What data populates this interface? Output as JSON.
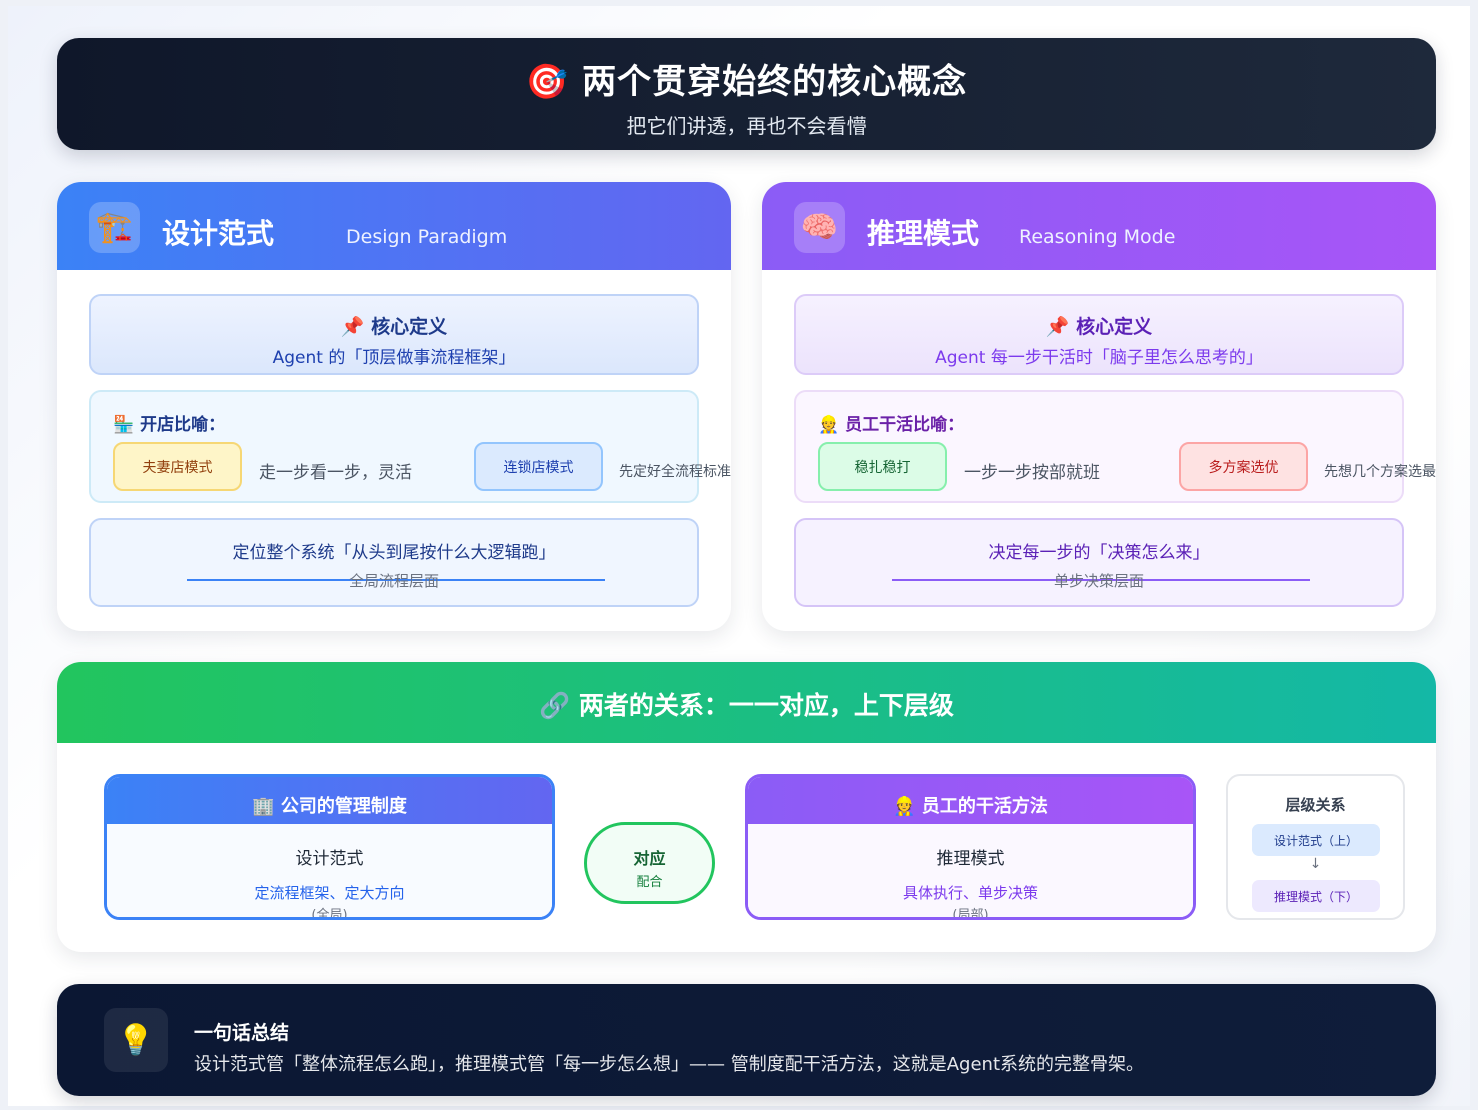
{
  "header": {
    "icon": "target-icon",
    "title": "🎯 两个贯穿始终的核心概念",
    "subtitle": "把它们讲透，再也不会看懵"
  },
  "design": {
    "icon_name": "crane-icon",
    "icon": "🏗️",
    "title": "设计范式",
    "subtitle": "Design Paradigm",
    "def_label": "📌 核心定义",
    "def_text": "Agent 的「顶层做事流程框架」",
    "metaphor_label": "🏪 开店比喻：",
    "chip1": "夫妻店模式",
    "chip1_text": "走一步看一步，灵活",
    "chip2": "连锁店模式",
    "chip2_text": "先定好全流程标准",
    "position_text": "定位整个系统「从头到尾按什么大逻辑跑」",
    "position_tag": "全局流程层面",
    "color": "#3b82f6"
  },
  "reasoning": {
    "icon_name": "brain-icon",
    "icon": "🧠",
    "title": "推理模式",
    "subtitle": "Reasoning Mode",
    "def_label": "📌 核心定义",
    "def_text": "Agent 每一步干活时「脑子里怎么思考的」",
    "metaphor_label": "👷 员工干活比喻：",
    "chip1": "稳扎稳打",
    "chip1_text": "一步一步按部就班",
    "chip2": "多方案选优",
    "chip2_text": "先想几个方案选最优",
    "position_text": "决定每一步的「决策怎么来」",
    "position_tag": "单步决策层面",
    "color": "#8b5cf6"
  },
  "relation": {
    "title": "🔗 两者的关系：一一对应，上下层级",
    "left": {
      "head": "🏢 公司的管理制度",
      "name": "设计范式",
      "desc": "定流程框架、定大方向",
      "scope": "(全局)"
    },
    "match": {
      "top": "对应",
      "bottom": "配合"
    },
    "right": {
      "head": "👷 员工的干活方法",
      "name": "推理模式",
      "desc": "具体执行、单步决策",
      "scope": "(局部)"
    },
    "hierarchy": {
      "title": "层级关系",
      "top": "设计范式（上）",
      "arrow": "↓",
      "bottom": "推理模式（下）"
    },
    "color": "#22c55e"
  },
  "summary": {
    "icon_name": "lightbulb-icon",
    "icon": "💡",
    "title": "一句话总结",
    "text": "设计范式管「整体流程怎么跑」，推理模式管「每一步怎么想」—— 管制度配干活方法，这就是Agent系统的完整骨架。"
  }
}
